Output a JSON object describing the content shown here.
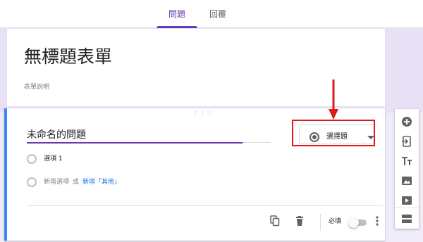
{
  "tabs": [
    {
      "label": "問題",
      "active": true
    },
    {
      "label": "回覆",
      "active": false
    }
  ],
  "form": {
    "title": "無標題表單",
    "description": "表單說明"
  },
  "question": {
    "title": "未命名的問題",
    "type_label": "選擇題",
    "options": [
      {
        "label": "選項 1"
      }
    ],
    "add_option": "新增選項",
    "or": "或",
    "add_other": "新增「其他」",
    "required_label": "必填",
    "required_on": false
  },
  "icons": {
    "copy": "copy-icon",
    "delete": "trash-icon",
    "more": "more-vert-icon",
    "radio": "radio-button-icon",
    "dropdown": "chevron-down-icon"
  },
  "side_toolbar": [
    {
      "name": "add-question-icon"
    },
    {
      "name": "import-questions-icon"
    },
    {
      "name": "add-title-icon"
    },
    {
      "name": "add-image-icon"
    },
    {
      "name": "add-video-icon"
    },
    {
      "name": "add-section-icon"
    }
  ],
  "colors": {
    "accent": "#673ab7",
    "background": "#f0ebf8",
    "active_border": "#4285f4",
    "link": "#1a73e8",
    "annotation": "#e01a1a"
  }
}
